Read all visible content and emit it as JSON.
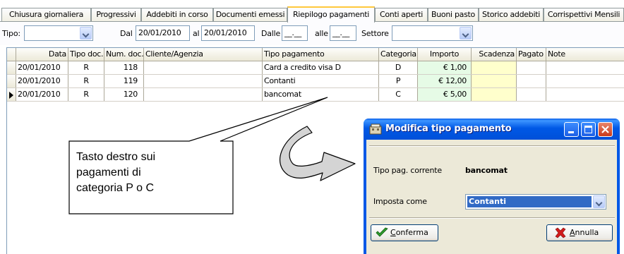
{
  "tabs": [
    {
      "label": "Chiusura giornaliera"
    },
    {
      "label": "Progressivi"
    },
    {
      "label": "Addebiti in corso"
    },
    {
      "label": "Documenti emessi"
    },
    {
      "label": "Riepilogo pagamenti",
      "active": true
    },
    {
      "label": "Conti aperti"
    },
    {
      "label": "Buoni pasto"
    },
    {
      "label": "Storico addebiti"
    },
    {
      "label": "Corrispettivi Mensili"
    }
  ],
  "filters": {
    "tipo_label": "Tipo:",
    "tipo_value": "",
    "dal_label": "Dal",
    "dal_value": "20/01/2010",
    "al_label": "al",
    "al_value": "20/01/2010",
    "dalle_label": "Dalle",
    "dalle_value": "__.__",
    "alle_label": "alle",
    "alle_value": "__.__",
    "settore_label": "Settore",
    "settore_value": ""
  },
  "grid": {
    "columns": [
      "Data",
      "Tipo doc.",
      "Num. doc.",
      "Cliente/Agenzia",
      "Tipo pagamento",
      "Categoria",
      "Importo",
      "Scadenza",
      "Pagato",
      "Note"
    ],
    "rows": [
      {
        "data": "20/01/2010",
        "tipo_doc": "R",
        "num_doc": "118",
        "cliente": "",
        "tipo_pagamento": "Card a credito  visa D",
        "categoria": "D",
        "importo": "€ 1,00",
        "scadenza": "",
        "pagato": "",
        "note": ""
      },
      {
        "data": "20/01/2010",
        "tipo_doc": "R",
        "num_doc": "119",
        "cliente": "",
        "tipo_pagamento": "Contanti",
        "categoria": "P",
        "importo": "€ 12,00",
        "scadenza": "",
        "pagato": "",
        "note": ""
      },
      {
        "data": "20/01/2010",
        "tipo_doc": "R",
        "num_doc": "120",
        "cliente": "",
        "tipo_pagamento": "bancomat",
        "categoria": "C",
        "importo": "€ 5,00",
        "scadenza": "",
        "pagato": "",
        "note": ""
      }
    ]
  },
  "annotation": {
    "line1": "Tasto destro sui",
    "line2": "pagamenti di",
    "line3": "categoria P o C"
  },
  "dialog": {
    "title": "Modifica tipo pagamento",
    "current_label": "Tipo pag. corrente",
    "current_value": "bancomat",
    "set_label": "Imposta come",
    "set_value": "Contanti",
    "confirm_label": "Conferma",
    "cancel_label": "Annulla"
  },
  "icons": {
    "combo": "chevron-down-icon",
    "row_pointer": "row-pointer-icon",
    "confirm": "checkmark-icon",
    "cancel": "x-icon",
    "window": "window-icon"
  },
  "colors": {
    "importo_bg": "#e6fbe6",
    "scadenza_bg": "#ffffcc",
    "title_bar": "#0058e6",
    "active_tab": "#ffc83c",
    "selection": "#316ac5"
  }
}
